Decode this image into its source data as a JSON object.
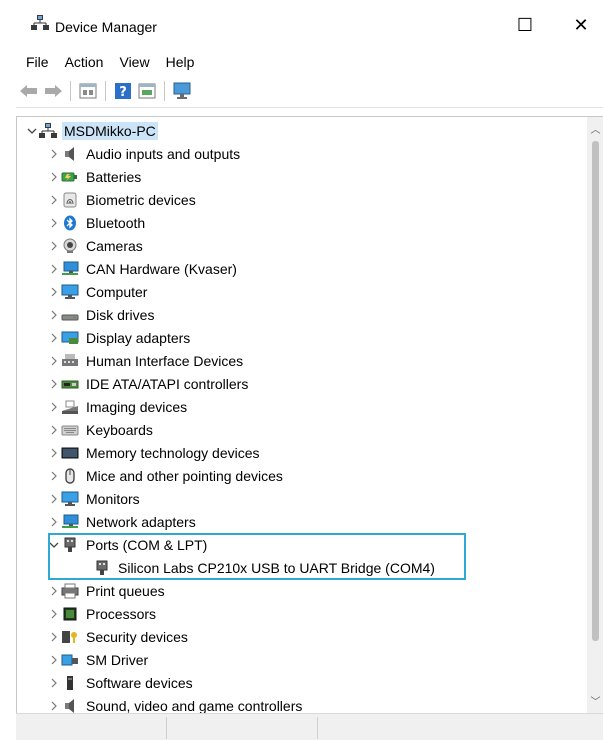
{
  "window": {
    "title": "Device Manager",
    "minimize_glyph": "☐",
    "close_glyph": "✕",
    "app_icon": "computer-tree-icon"
  },
  "menu": [
    "File",
    "Action",
    "View",
    "Help"
  ],
  "toolbar": {
    "buttons": [
      "back-arrow-icon",
      "forward-arrow-icon",
      "properties-icon",
      "help-icon",
      "view-icon",
      "scan-monitor-icon"
    ]
  },
  "tree": {
    "root": {
      "label": "MSDMikko-PC",
      "icon": "computer-tree-icon",
      "expanded": true
    },
    "categories": [
      {
        "label": "Audio inputs and outputs",
        "icon": "speaker-icon"
      },
      {
        "label": "Batteries",
        "icon": "battery-icon"
      },
      {
        "label": "Biometric devices",
        "icon": "fingerprint-icon"
      },
      {
        "label": "Bluetooth",
        "icon": "bluetooth-icon"
      },
      {
        "label": "Cameras",
        "icon": "camera-icon"
      },
      {
        "label": "CAN Hardware (Kvaser)",
        "icon": "network-monitor-icon"
      },
      {
        "label": "Computer",
        "icon": "monitor-icon"
      },
      {
        "label": "Disk drives",
        "icon": "disk-drive-icon"
      },
      {
        "label": "Display adapters",
        "icon": "display-adapter-icon"
      },
      {
        "label": "Human Interface Devices",
        "icon": "hid-icon"
      },
      {
        "label": "IDE ATA/ATAPI controllers",
        "icon": "ide-controller-icon"
      },
      {
        "label": "Imaging devices",
        "icon": "scanner-icon"
      },
      {
        "label": "Keyboards",
        "icon": "keyboard-icon"
      },
      {
        "label": "Memory technology devices",
        "icon": "memory-card-icon"
      },
      {
        "label": "Mice and other pointing devices",
        "icon": "mouse-icon"
      },
      {
        "label": "Monitors",
        "icon": "monitor-icon"
      },
      {
        "label": "Network adapters",
        "icon": "network-monitor-icon"
      },
      {
        "label": "Ports (COM & LPT)",
        "icon": "port-plug-icon",
        "expanded": true,
        "children": [
          {
            "label": "Silicon Labs CP210x USB to UART Bridge (COM4)",
            "icon": "port-plug-icon"
          }
        ]
      },
      {
        "label": "Print queues",
        "icon": "printer-icon"
      },
      {
        "label": "Processors",
        "icon": "processor-icon"
      },
      {
        "label": "Security devices",
        "icon": "security-key-icon"
      },
      {
        "label": "SM Driver",
        "icon": "sm-driver-icon"
      },
      {
        "label": "Software devices",
        "icon": "software-device-icon"
      },
      {
        "label": "Sound, video and game controllers",
        "icon": "speaker-icon"
      }
    ]
  },
  "colors": {
    "selection": "#cce4f7",
    "highlight_box": "#31a8d4",
    "icon_blue": "#1e78d2"
  }
}
